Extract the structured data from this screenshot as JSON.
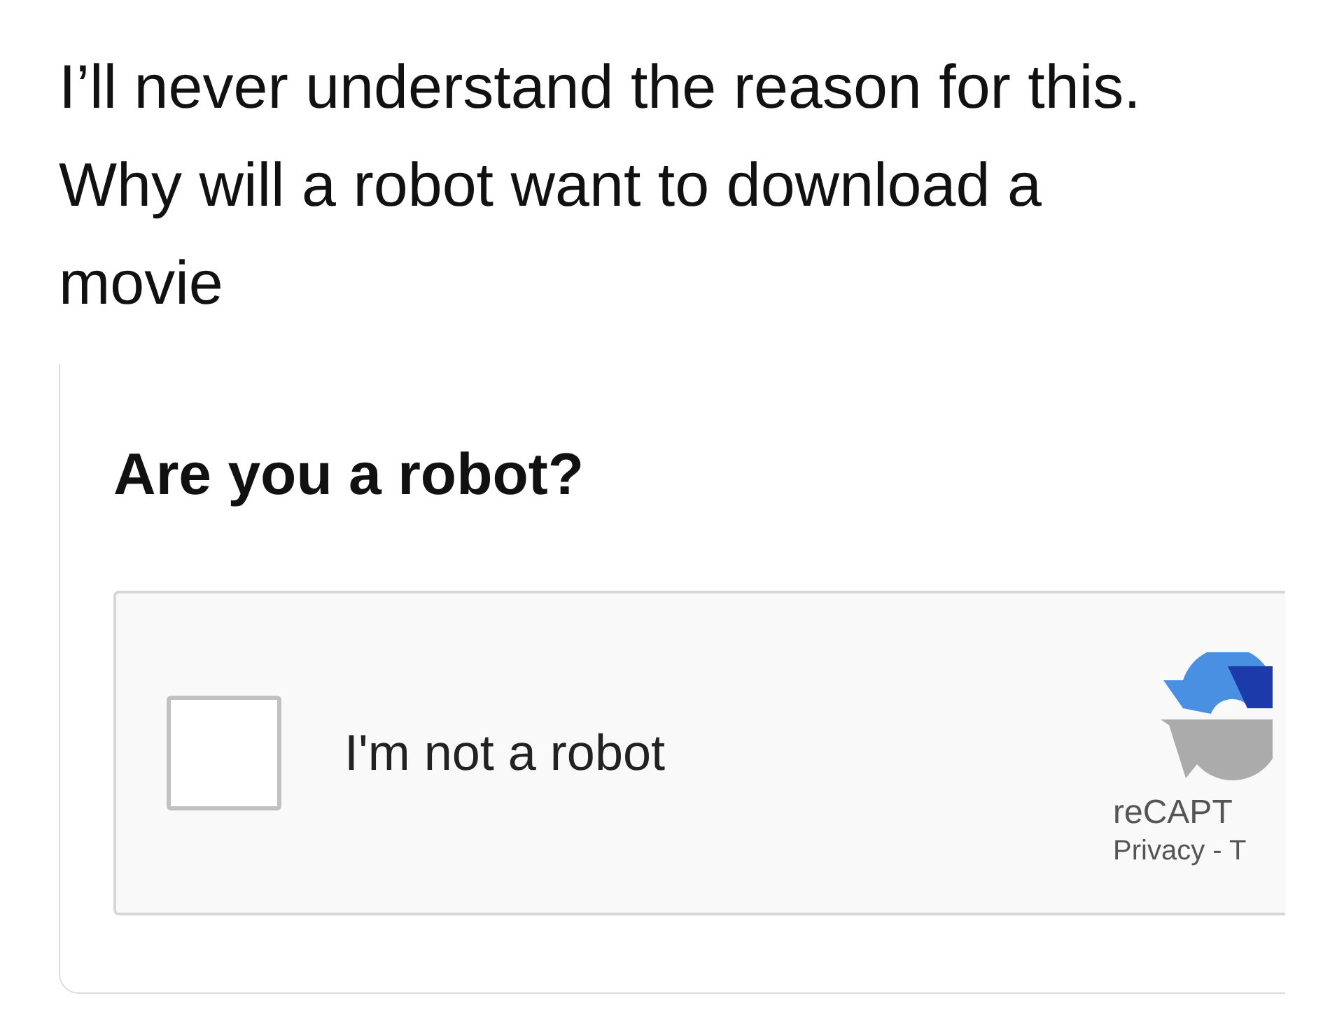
{
  "caption": "I’ll never understand the reason for this. Why will a robot want to download a movie",
  "card": {
    "title": "Are you a robot?",
    "captcha": {
      "checkbox": {
        "label": "I'm not a robot",
        "checked": false
      },
      "brand": "reCAPT",
      "links": "Privacy - T"
    }
  }
}
